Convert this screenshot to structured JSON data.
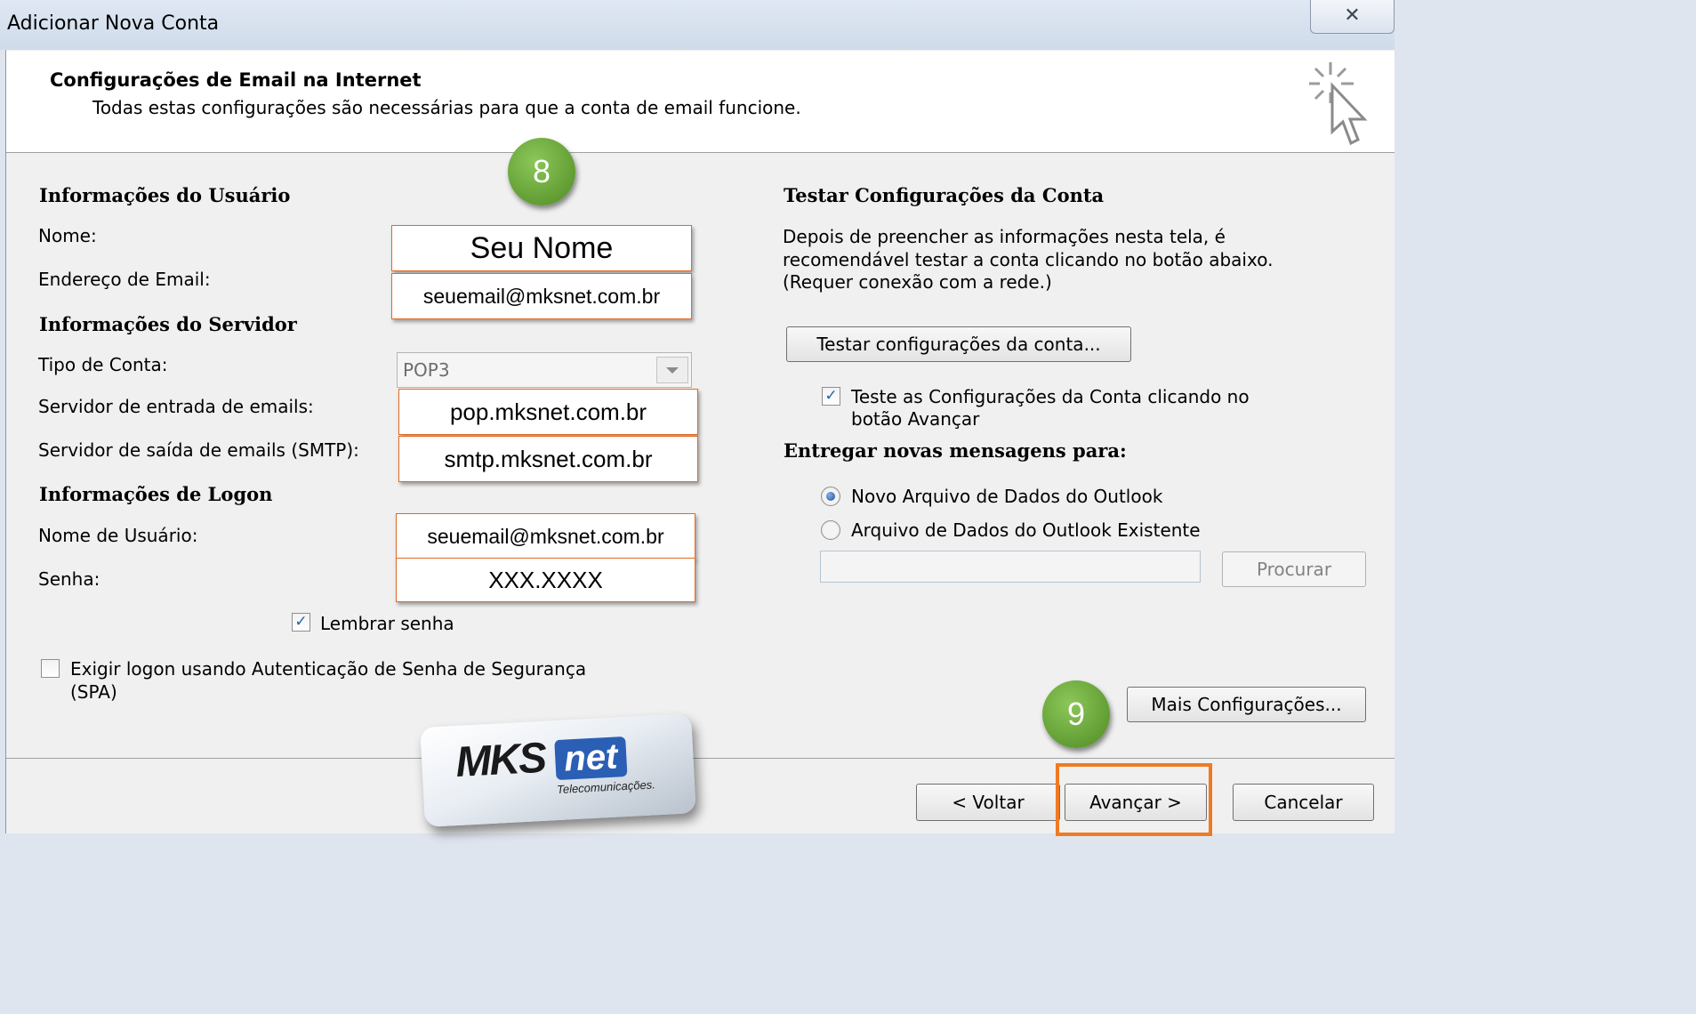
{
  "window": {
    "title": "Adicionar Nova Conta",
    "close_glyph": "✕"
  },
  "header": {
    "title": "Configurações de Email na Internet",
    "subtitle": "Todas estas configurações são necessárias para que a conta de email funcione."
  },
  "user_info": {
    "section_title": "Informações do Usuário",
    "name_label": "Nome:",
    "name_value": "Seu Nome",
    "email_label": "Endereço de Email:",
    "email_value": "seuemail@mksnet.com.br"
  },
  "server_info": {
    "section_title": "Informações do Servidor",
    "account_type_label": "Tipo de Conta:",
    "account_type_value": "POP3",
    "incoming_label": "Servidor de entrada de emails:",
    "incoming_value": "pop.mksnet.com.br",
    "outgoing_label": "Servidor de saída de emails (SMTP):",
    "outgoing_value": "smtp.mksnet.com.br"
  },
  "logon_info": {
    "section_title": "Informações de Logon",
    "username_label": "Nome de Usuário:",
    "username_value": "seuemail@mksnet.com.br",
    "password_label": "Senha:",
    "password_value": "XXX.XXXX",
    "remember_label": "Lembrar senha",
    "remember_checked": true,
    "spa_label_line1": "Exigir logon usando Autenticação de Senha de Segurança",
    "spa_label_line2": "(SPA)",
    "spa_checked": false
  },
  "test_settings": {
    "section_title": "Testar Configurações da Conta",
    "desc_line1": "Depois de preencher as informações nesta tela, é",
    "desc_line2": "recomendável testar a conta clicando no botão abaixo.",
    "desc_line3": "(Requer conexão com a rede.)",
    "test_button": "Testar configurações da conta...",
    "auto_test_line1": "Teste as Configurações da Conta clicando no",
    "auto_test_line2": "botão Avançar",
    "auto_test_checked": true
  },
  "deliver": {
    "section_title": "Entregar novas mensagens para:",
    "option_new": "Novo Arquivo de Dados do Outlook",
    "option_existing": "Arquivo de Dados do Outlook Existente",
    "selected": "option_new",
    "browse_button": "Procurar"
  },
  "more_settings_button": "Mais Configurações...",
  "footer": {
    "back": "< Voltar",
    "next": "Avançar >",
    "cancel": "Cancelar"
  },
  "annotations": {
    "step_8": "8",
    "step_9": "9"
  },
  "logo": {
    "brand_a": "MKS",
    "brand_b": "net",
    "tagline": "Telecomunicações."
  },
  "colors": {
    "highlight": "#f07a22",
    "badge_green": "#5e9a2e",
    "logo_blue": "#2a5fb5"
  }
}
